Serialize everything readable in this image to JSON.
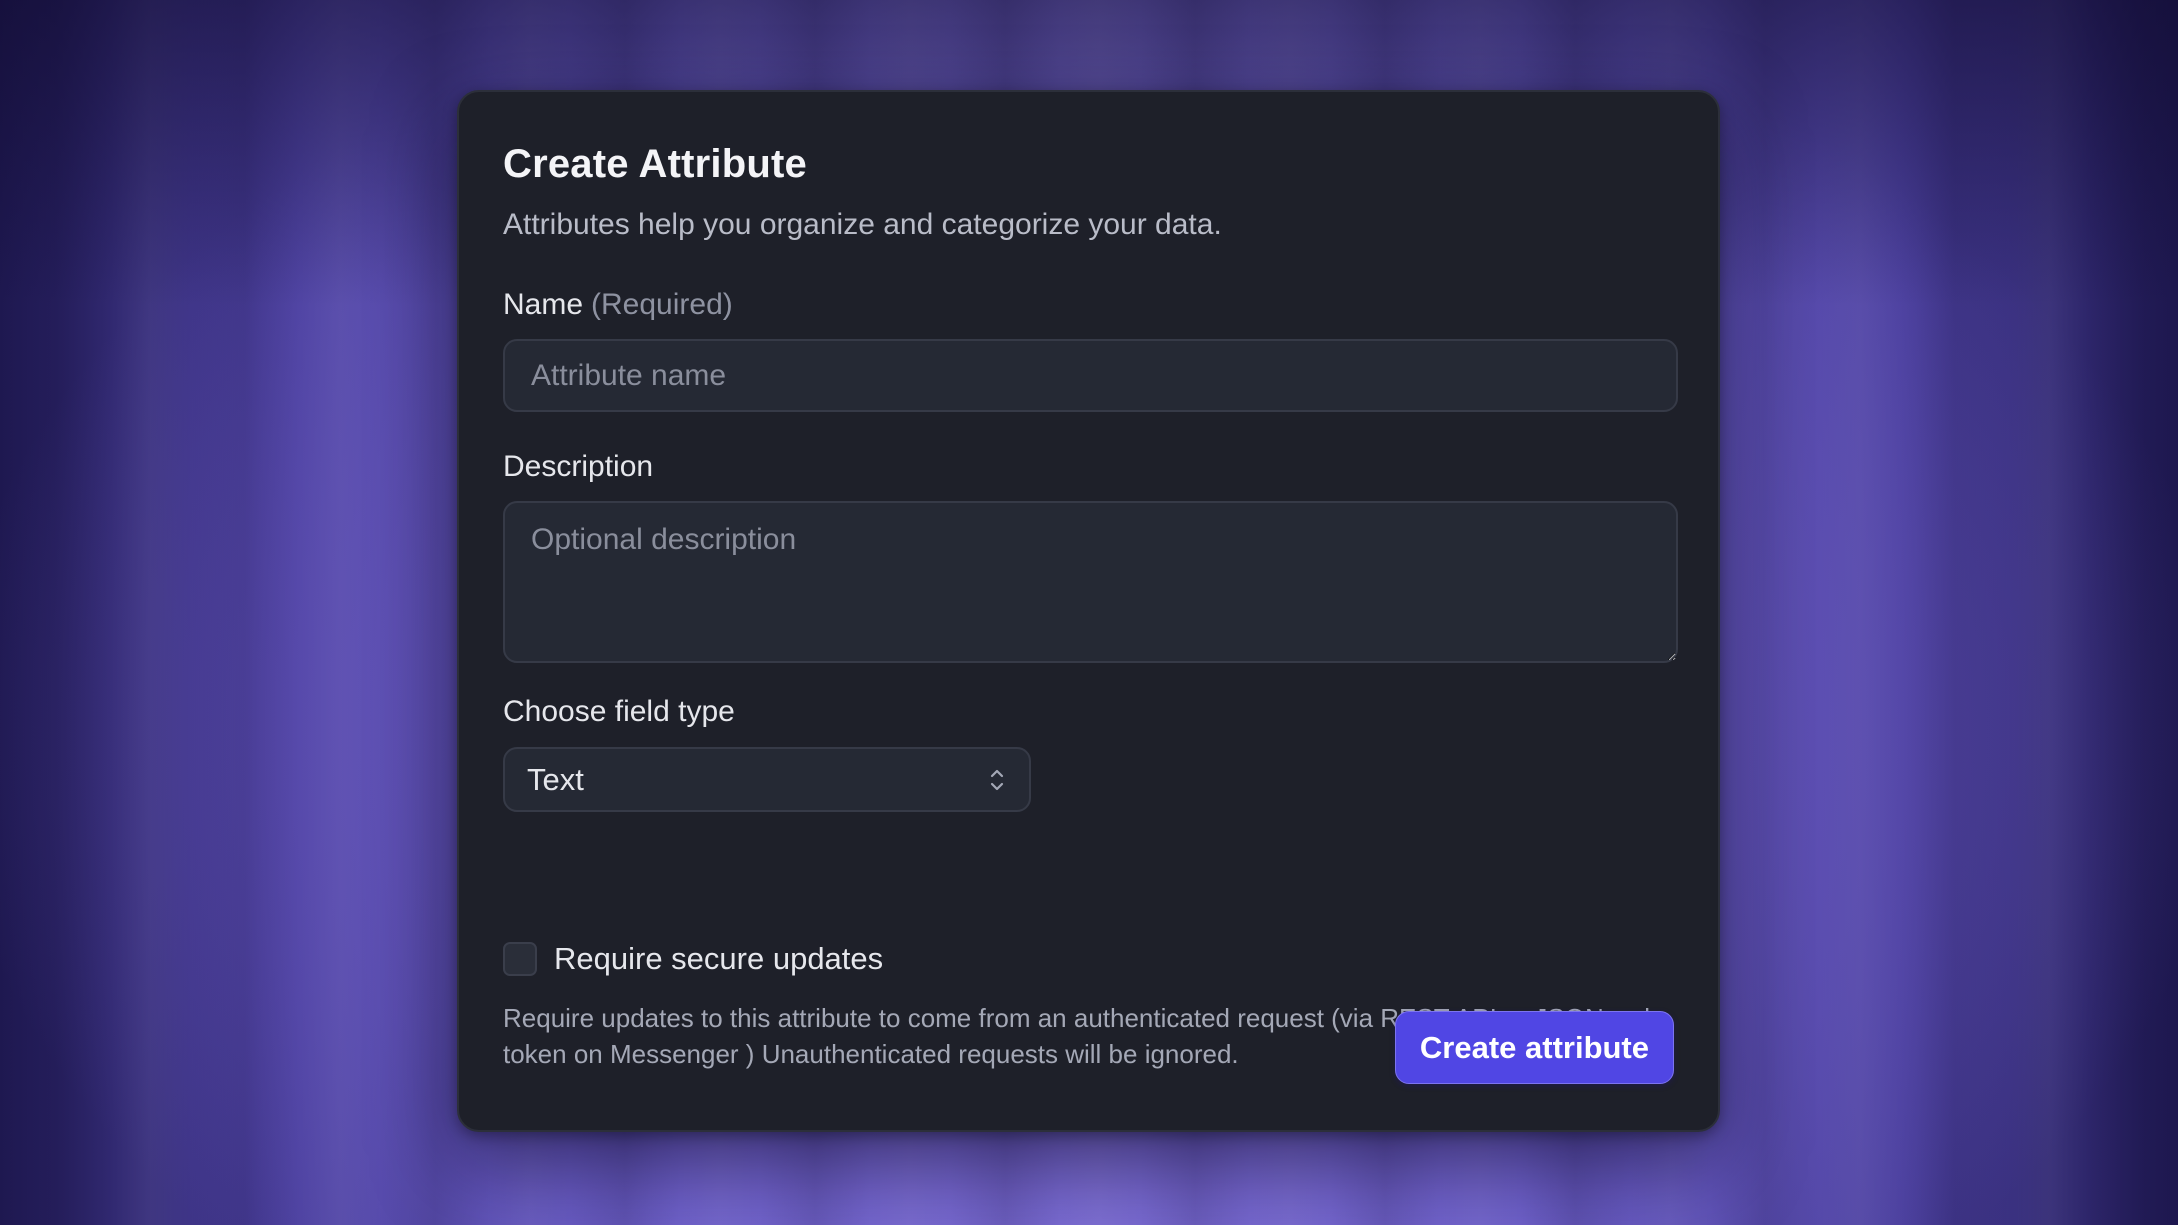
{
  "dialog": {
    "title": "Create Attribute",
    "subtitle": "Attributes help you organize and categorize your data."
  },
  "name_field": {
    "label": "Name",
    "required_hint": "(Required)",
    "placeholder": "Attribute name",
    "value": ""
  },
  "description_field": {
    "label": "Description",
    "placeholder": "Optional description",
    "value": ""
  },
  "field_type": {
    "label": "Choose field type",
    "selected": "Text",
    "icon": "chevron-up-down-icon"
  },
  "secure_updates": {
    "label": "Require secure updates",
    "checked": false,
    "help_text": "Require updates to this attribute to come from an authenticated request (via REST API or JSON web token on Messenger ) Unauthenticated requests will be ignored."
  },
  "actions": {
    "submit_label": "Create attribute"
  },
  "colors": {
    "dialog_bg": "#1e2029",
    "input_bg": "#252934",
    "accent": "#5046e4",
    "background_purple": "#7a6dd0"
  }
}
